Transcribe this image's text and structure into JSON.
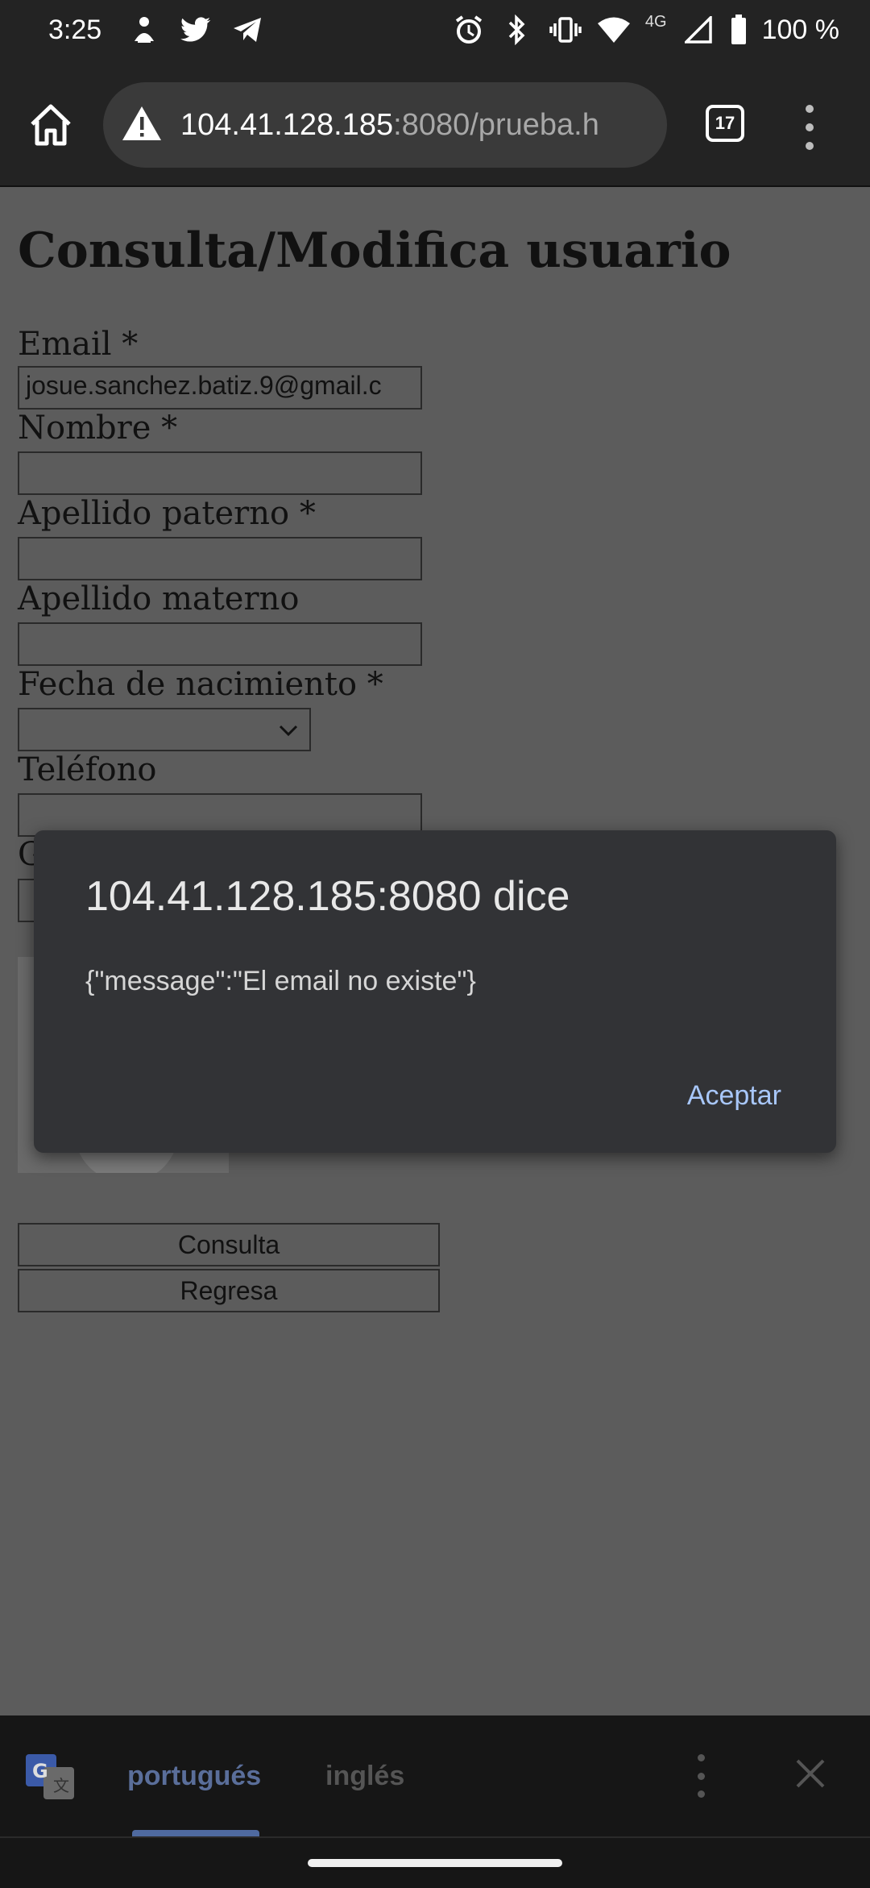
{
  "status_bar": {
    "time": "3:25",
    "left_icons": [
      "notification-icon",
      "twitter-icon",
      "telegram-icon"
    ],
    "right_icons": [
      "alarm-icon",
      "bluetooth-icon",
      "vibrate-icon",
      "wifi-icon",
      "signal-4g-icon",
      "battery-icon"
    ],
    "network": "4G",
    "battery": "100 %"
  },
  "browser": {
    "url_host": "104.41.128.185",
    "url_rest": ":8080/prueba.h",
    "tab_count": "17"
  },
  "page": {
    "title": "Consulta/Modifica usuario",
    "fields": {
      "email_label": "Email *",
      "email_value": "josue.sanchez.batiz.9@gmail.c",
      "nombre_label": "Nombre *",
      "apellido_paterno_label": "Apellido paterno *",
      "apellido_materno_label": "Apellido materno",
      "fecha_label": "Fecha de nacimiento *",
      "telefono_label": "Teléfono",
      "genero_label_partial": "G"
    },
    "buttons": {
      "consulta": "Consulta",
      "regresa": "Regresa"
    }
  },
  "dialog": {
    "title": "104.41.128.185:8080 dice",
    "message": "{\"message\":\"El email no existe\"}",
    "ok": "Aceptar"
  },
  "translate_bar": {
    "active_language": "portugués",
    "other_language": "inglés"
  },
  "colors": {
    "accent": "#a8c7fa",
    "dialog_bg": "#323336",
    "scrim": "#5c5c5c"
  }
}
